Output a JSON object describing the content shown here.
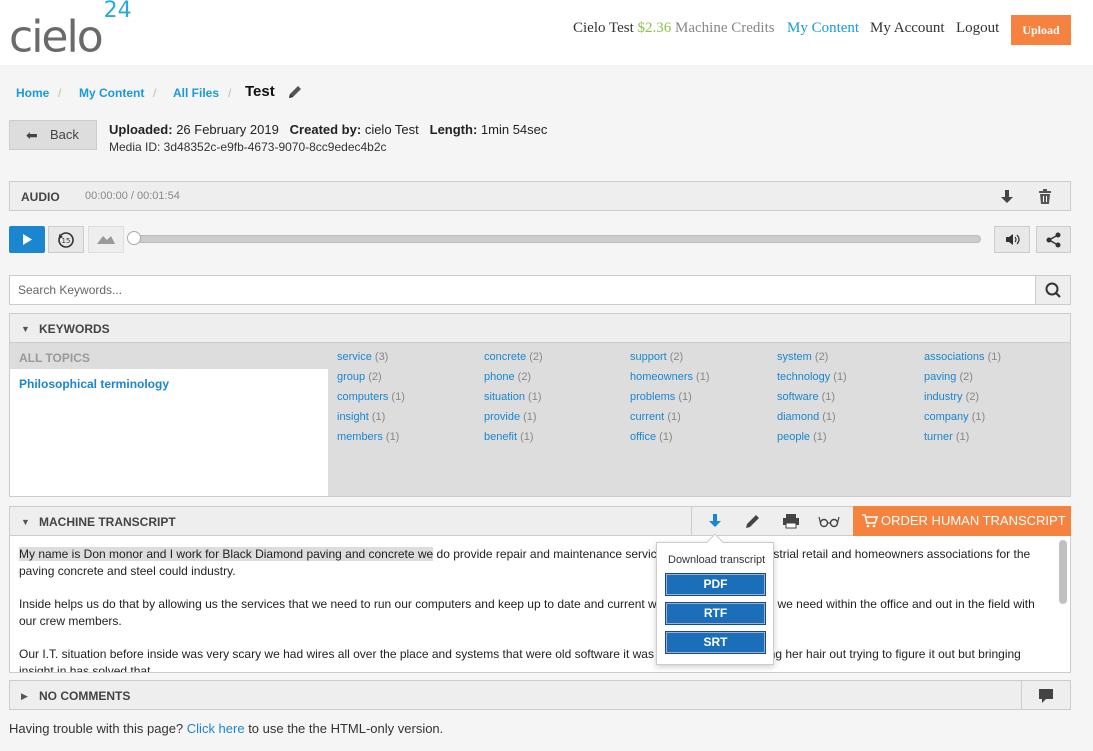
{
  "header": {
    "logo_text": "cielo",
    "logo_sup": "24",
    "user_name": "Cielo Test",
    "credits": "$2.36",
    "credits_label": "Machine Credits",
    "nav_my_content": "My Content",
    "nav_my_account": "My Account",
    "nav_logout": "Logout",
    "upload_label": "Upload"
  },
  "breadcrumb": {
    "items": [
      "Home",
      "My Content",
      "All Files"
    ],
    "current": "Test"
  },
  "media": {
    "back_label": "Back",
    "uploaded_label": "Uploaded:",
    "uploaded_value": "26 February 2019",
    "created_label": "Created by:",
    "created_value": "cielo Test",
    "length_label": "Length:",
    "length_value": "1min 54sec",
    "media_id": "Media ID: 3d48352c-e9fb-4673-9070-8cc9edec4b2c"
  },
  "audio": {
    "label": "AUDIO",
    "time": "00:00:00 / 00:01:54",
    "progress": 0
  },
  "search": {
    "placeholder": "Search Keywords..."
  },
  "keywords": {
    "title": "KEYWORDS",
    "topics_header": "ALL TOPICS",
    "topic": "Philosophical terminology",
    "columns": [
      [
        {
          "word": "service",
          "count": "(3)"
        },
        {
          "word": "group",
          "count": "(2)"
        },
        {
          "word": "computers",
          "count": "(1)"
        },
        {
          "word": "insight",
          "count": "(1)"
        },
        {
          "word": "members",
          "count": "(1)"
        }
      ],
      [
        {
          "word": "concrete",
          "count": "(2)"
        },
        {
          "word": "phone",
          "count": "(2)"
        },
        {
          "word": "situation",
          "count": "(1)"
        },
        {
          "word": "provide",
          "count": "(1)"
        },
        {
          "word": "benefit",
          "count": "(1)"
        }
      ],
      [
        {
          "word": "support",
          "count": "(2)"
        },
        {
          "word": "homeowners",
          "count": "(1)"
        },
        {
          "word": "problems",
          "count": "(1)"
        },
        {
          "word": "current",
          "count": "(1)"
        },
        {
          "word": "office",
          "count": "(1)"
        }
      ],
      [
        {
          "word": "system",
          "count": "(2)"
        },
        {
          "word": "technology",
          "count": "(1)"
        },
        {
          "word": "software",
          "count": "(1)"
        },
        {
          "word": "diamond",
          "count": "(1)"
        },
        {
          "word": "people",
          "count": "(1)"
        }
      ],
      [
        {
          "word": "associations",
          "count": "(1)"
        },
        {
          "word": "paving",
          "count": "(2)"
        },
        {
          "word": "industry",
          "count": "(2)"
        },
        {
          "word": "company",
          "count": "(1)"
        },
        {
          "word": "turner",
          "count": "(1)"
        }
      ]
    ]
  },
  "transcript": {
    "title": "MACHINE TRANSCRIPT",
    "order_label": "ORDER HUMAN TRANSCRIPT",
    "highlight": "My name is Don monor and I work for Black Diamond paving and concrete we",
    "p1_rest": " do provide repair and maintenance services to commercial industrial retail and homeowners associations for the paving concrete and steel could industry.",
    "p2": "Inside helps us do that by allowing us the services that we need to run our computers and keep up to date and current with the technology that we need within the office and out in the field with our crew members.",
    "p3": "Our I.T. situation before inside was very scary we had wires all over the place and systems that were old software it was old and she was pulling her hair out trying to figure it out but bringing insight in has solved that."
  },
  "download": {
    "title": "Download transcript",
    "pdf": "PDF",
    "rtf": "RTF",
    "srt": "SRT"
  },
  "comments": {
    "title": "NO COMMENTS"
  },
  "footer": {
    "prefix": "Having trouble with this page? ",
    "link": "Click here",
    "suffix": " to use the the HTML-only version."
  },
  "colors": {
    "accent_blue": "#1a86d0",
    "orange": "#f5823e",
    "credit_green": "#8bc34a"
  }
}
